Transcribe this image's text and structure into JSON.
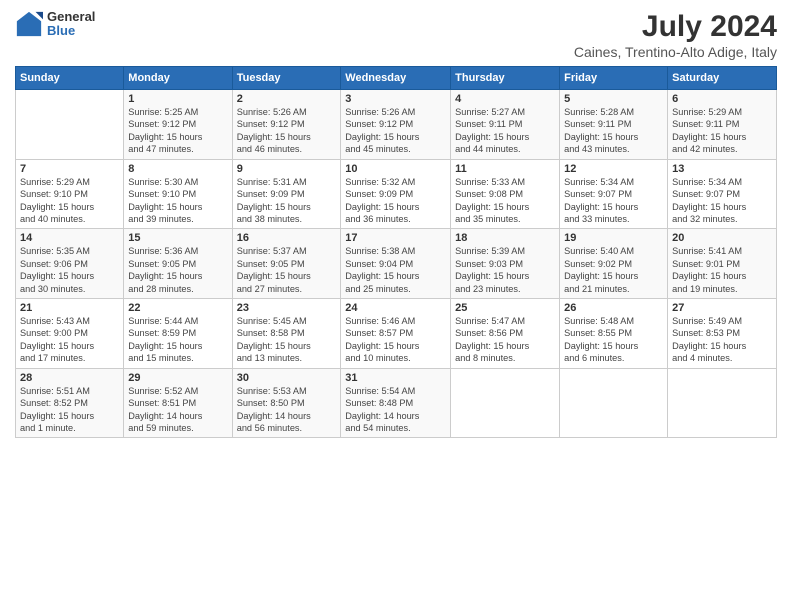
{
  "logo": {
    "general": "General",
    "blue": "Blue"
  },
  "title": "July 2024",
  "subtitle": "Caines, Trentino-Alto Adige, Italy",
  "weekdays": [
    "Sunday",
    "Monday",
    "Tuesday",
    "Wednesday",
    "Thursday",
    "Friday",
    "Saturday"
  ],
  "weeks": [
    [
      {
        "day": "",
        "info": ""
      },
      {
        "day": "1",
        "info": "Sunrise: 5:25 AM\nSunset: 9:12 PM\nDaylight: 15 hours\nand 47 minutes."
      },
      {
        "day": "2",
        "info": "Sunrise: 5:26 AM\nSunset: 9:12 PM\nDaylight: 15 hours\nand 46 minutes."
      },
      {
        "day": "3",
        "info": "Sunrise: 5:26 AM\nSunset: 9:12 PM\nDaylight: 15 hours\nand 45 minutes."
      },
      {
        "day": "4",
        "info": "Sunrise: 5:27 AM\nSunset: 9:11 PM\nDaylight: 15 hours\nand 44 minutes."
      },
      {
        "day": "5",
        "info": "Sunrise: 5:28 AM\nSunset: 9:11 PM\nDaylight: 15 hours\nand 43 minutes."
      },
      {
        "day": "6",
        "info": "Sunrise: 5:29 AM\nSunset: 9:11 PM\nDaylight: 15 hours\nand 42 minutes."
      }
    ],
    [
      {
        "day": "7",
        "info": "Sunrise: 5:29 AM\nSunset: 9:10 PM\nDaylight: 15 hours\nand 40 minutes."
      },
      {
        "day": "8",
        "info": "Sunrise: 5:30 AM\nSunset: 9:10 PM\nDaylight: 15 hours\nand 39 minutes."
      },
      {
        "day": "9",
        "info": "Sunrise: 5:31 AM\nSunset: 9:09 PM\nDaylight: 15 hours\nand 38 minutes."
      },
      {
        "day": "10",
        "info": "Sunrise: 5:32 AM\nSunset: 9:09 PM\nDaylight: 15 hours\nand 36 minutes."
      },
      {
        "day": "11",
        "info": "Sunrise: 5:33 AM\nSunset: 9:08 PM\nDaylight: 15 hours\nand 35 minutes."
      },
      {
        "day": "12",
        "info": "Sunrise: 5:34 AM\nSunset: 9:07 PM\nDaylight: 15 hours\nand 33 minutes."
      },
      {
        "day": "13",
        "info": "Sunrise: 5:34 AM\nSunset: 9:07 PM\nDaylight: 15 hours\nand 32 minutes."
      }
    ],
    [
      {
        "day": "14",
        "info": "Sunrise: 5:35 AM\nSunset: 9:06 PM\nDaylight: 15 hours\nand 30 minutes."
      },
      {
        "day": "15",
        "info": "Sunrise: 5:36 AM\nSunset: 9:05 PM\nDaylight: 15 hours\nand 28 minutes."
      },
      {
        "day": "16",
        "info": "Sunrise: 5:37 AM\nSunset: 9:05 PM\nDaylight: 15 hours\nand 27 minutes."
      },
      {
        "day": "17",
        "info": "Sunrise: 5:38 AM\nSunset: 9:04 PM\nDaylight: 15 hours\nand 25 minutes."
      },
      {
        "day": "18",
        "info": "Sunrise: 5:39 AM\nSunset: 9:03 PM\nDaylight: 15 hours\nand 23 minutes."
      },
      {
        "day": "19",
        "info": "Sunrise: 5:40 AM\nSunset: 9:02 PM\nDaylight: 15 hours\nand 21 minutes."
      },
      {
        "day": "20",
        "info": "Sunrise: 5:41 AM\nSunset: 9:01 PM\nDaylight: 15 hours\nand 19 minutes."
      }
    ],
    [
      {
        "day": "21",
        "info": "Sunrise: 5:43 AM\nSunset: 9:00 PM\nDaylight: 15 hours\nand 17 minutes."
      },
      {
        "day": "22",
        "info": "Sunrise: 5:44 AM\nSunset: 8:59 PM\nDaylight: 15 hours\nand 15 minutes."
      },
      {
        "day": "23",
        "info": "Sunrise: 5:45 AM\nSunset: 8:58 PM\nDaylight: 15 hours\nand 13 minutes."
      },
      {
        "day": "24",
        "info": "Sunrise: 5:46 AM\nSunset: 8:57 PM\nDaylight: 15 hours\nand 10 minutes."
      },
      {
        "day": "25",
        "info": "Sunrise: 5:47 AM\nSunset: 8:56 PM\nDaylight: 15 hours\nand 8 minutes."
      },
      {
        "day": "26",
        "info": "Sunrise: 5:48 AM\nSunset: 8:55 PM\nDaylight: 15 hours\nand 6 minutes."
      },
      {
        "day": "27",
        "info": "Sunrise: 5:49 AM\nSunset: 8:53 PM\nDaylight: 15 hours\nand 4 minutes."
      }
    ],
    [
      {
        "day": "28",
        "info": "Sunrise: 5:51 AM\nSunset: 8:52 PM\nDaylight: 15 hours\nand 1 minute."
      },
      {
        "day": "29",
        "info": "Sunrise: 5:52 AM\nSunset: 8:51 PM\nDaylight: 14 hours\nand 59 minutes."
      },
      {
        "day": "30",
        "info": "Sunrise: 5:53 AM\nSunset: 8:50 PM\nDaylight: 14 hours\nand 56 minutes."
      },
      {
        "day": "31",
        "info": "Sunrise: 5:54 AM\nSunset: 8:48 PM\nDaylight: 14 hours\nand 54 minutes."
      },
      {
        "day": "",
        "info": ""
      },
      {
        "day": "",
        "info": ""
      },
      {
        "day": "",
        "info": ""
      }
    ]
  ]
}
